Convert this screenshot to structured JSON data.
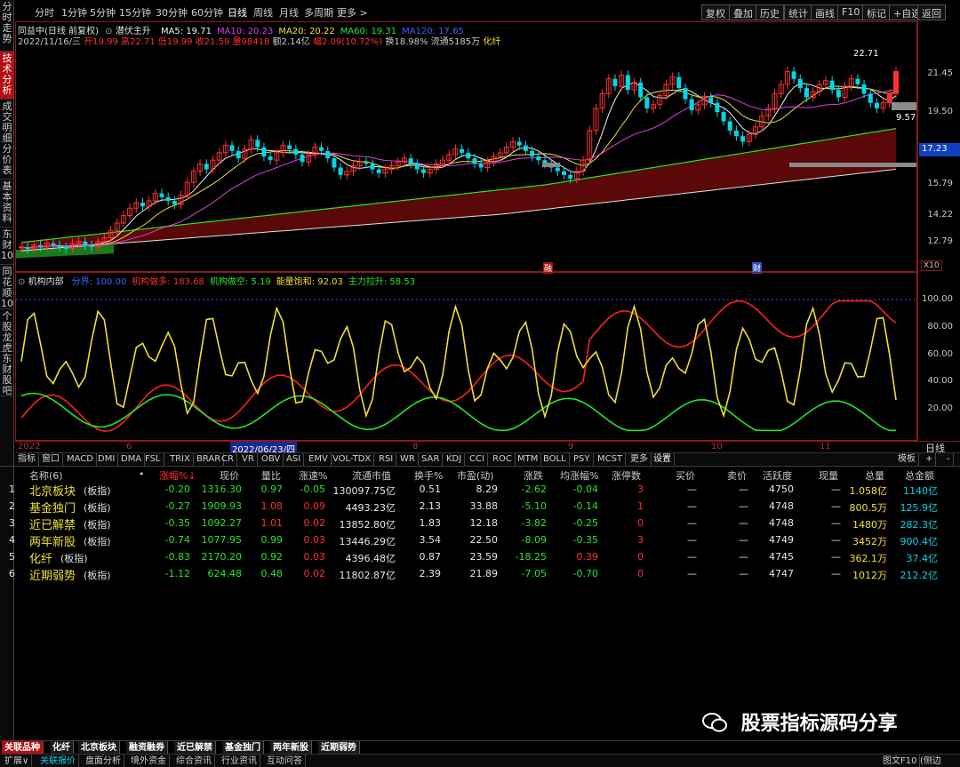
{
  "left_nav": [
    "分时走势",
    "技术分析",
    "成交明细",
    "分价表",
    "基本资料",
    "东财10",
    "同花顺10",
    "个股龙虎",
    "东财股吧"
  ],
  "toolbar": {
    "periods": [
      "分时",
      "1分钟",
      "5分钟",
      "15分钟",
      "30分钟",
      "60分钟",
      "日线",
      "周线",
      "月线",
      "多周期",
      "更多 >"
    ],
    "selected": "日线",
    "right_buttons": [
      "复权",
      "叠加",
      "历史",
      "统计",
      "画线",
      "F10",
      "标记",
      "+自选",
      "返回"
    ]
  },
  "main_chart": {
    "title": "同益中(日线 前复权)",
    "indicator": "潜伏主升",
    "ma": [
      {
        "label": "MA5: 19.71",
        "color": "#f0f0f0"
      },
      {
        "label": "MA10: 20.23",
        "color": "#e040e0"
      },
      {
        "label": "MA20: 20.22",
        "color": "#f0e030"
      },
      {
        "label": "MA60: 19.31",
        "color": "#27e627"
      },
      {
        "label": "MA120: 17.65",
        "color": "#4060ff"
      }
    ],
    "info": {
      "date": "2022/11/16/三",
      "open": "开19.99",
      "high": "高22.71",
      "low": "低19.99",
      "close": "收21.59",
      "vol": "量98418",
      "amount": "额2.14亿",
      "change": "幅2.09(10.72%)",
      "turnover": "换18.98%",
      "float": "流通5185万",
      "sector": "化纤"
    },
    "high_label": "22.71",
    "low_label": "9.57",
    "price_tag": "17.23",
    "markers": [
      "融",
      "财"
    ],
    "y_labels": [
      "21.45",
      "19.50",
      "17.23",
      "15.79",
      "14.22",
      "12.79"
    ],
    "x10": "X10"
  },
  "sub_chart": {
    "title": "机构内部",
    "legend": [
      {
        "label": "分界: 100.00",
        "color": "#4060ff"
      },
      {
        "label": "机构做多: 183.68",
        "color": "#ff3030"
      },
      {
        "label": "机构做空: 5.19",
        "color": "#27e627"
      },
      {
        "label": "能量饱和: 92.03",
        "color": "#f0e030"
      },
      {
        "label": "主力拉升: 58.53",
        "color": "#27e627"
      }
    ],
    "y_labels": [
      "100.00",
      "80.00",
      "60.00",
      "40.00",
      "20.00"
    ]
  },
  "date_axis": {
    "labels": [
      "2022",
      "6",
      "2022/06/23/四",
      "8",
      "9",
      "10",
      "11"
    ],
    "right": "日线"
  },
  "indicator_tabs": [
    "指标",
    "窗口",
    "MACD",
    "DMI",
    "DMA",
    "FSL",
    "TRIX",
    "BRAR",
    "CR",
    "VR",
    "OBV",
    "ASI",
    "EMV",
    "VOL-TDX",
    "RSI",
    "WR",
    "SAR",
    "KDJ",
    "CCI",
    "ROC",
    "MTM",
    "BOLL",
    "PSY",
    "MCST",
    "更多",
    "设置"
  ],
  "indicator_right": [
    "模板",
    "+",
    "-"
  ],
  "table": {
    "headers": [
      "名称(6)",
      "•",
      "涨幅%↓",
      "现价",
      "量比",
      "涨速%",
      "流通市值",
      "换手%",
      "市盈(动)",
      "涨跌",
      "均涨幅%",
      "涨停数",
      "买价",
      "卖价",
      "活跃度",
      "现量",
      "总量",
      "总金额"
    ],
    "rows": [
      {
        "idx": "1",
        "name": "北京板块",
        "tag": "(板指)",
        "chg": "-0.20",
        "price": "1316.30",
        "vr": "0.97",
        "spd": "-0.05",
        "mcap": "130097.75亿",
        "turn": "0.51",
        "pe": "8.29",
        "diff": "-2.62",
        "avg": "-0.04",
        "limit": "3",
        "bid": "—",
        "ask": "—",
        "act": "4750",
        "cur": "—",
        "vol": "1.058亿",
        "amt": "1140亿"
      },
      {
        "idx": "2",
        "name": "基金独门",
        "tag": "(板指)",
        "chg": "-0.27",
        "price": "1909.93",
        "vr": "1.08",
        "spd": "0.09",
        "mcap": "4493.23亿",
        "turn": "2.13",
        "pe": "33.88",
        "diff": "-5.10",
        "avg": "-0.14",
        "limit": "1",
        "bid": "—",
        "ask": "—",
        "act": "4748",
        "cur": "—",
        "vol": "800.5万",
        "amt": "125.9亿"
      },
      {
        "idx": "3",
        "name": "近已解禁",
        "tag": "(板指)",
        "chg": "-0.35",
        "price": "1092.27",
        "vr": "1.01",
        "spd": "0.02",
        "mcap": "13852.80亿",
        "turn": "1.83",
        "pe": "12.18",
        "diff": "-3.82",
        "avg": "-0.25",
        "limit": "0",
        "bid": "—",
        "ask": "—",
        "act": "4748",
        "cur": "—",
        "vol": "1480万",
        "amt": "282.3亿"
      },
      {
        "idx": "4",
        "name": "两年新股",
        "tag": "(板指)",
        "chg": "-0.74",
        "price": "1077.95",
        "vr": "0.99",
        "spd": "0.03",
        "mcap": "13446.29亿",
        "turn": "3.54",
        "pe": "22.50",
        "diff": "-8.09",
        "avg": "-0.35",
        "limit": "3",
        "bid": "—",
        "ask": "—",
        "act": "4749",
        "cur": "—",
        "vol": "3452万",
        "amt": "900.4亿"
      },
      {
        "idx": "5",
        "name": "化纤",
        "tag": "(板指)",
        "chg": "-0.83",
        "price": "2170.20",
        "vr": "0.92",
        "spd": "0.03",
        "mcap": "4396.48亿",
        "turn": "0.87",
        "pe": "23.59",
        "diff": "-18.25",
        "avg": "0.39",
        "limit": "0",
        "bid": "—",
        "ask": "—",
        "act": "4745",
        "cur": "—",
        "vol": "362.1万",
        "amt": "37.4亿"
      },
      {
        "idx": "6",
        "name": "近期弱势",
        "tag": "(板指)",
        "chg": "-1.12",
        "price": "624.48",
        "vr": "0.48",
        "spd": "0.02",
        "mcap": "11802.87亿",
        "turn": "2.39",
        "pe": "21.89",
        "diff": "-7.05",
        "avg": "-0.70",
        "limit": "0",
        "bid": "—",
        "ask": "—",
        "act": "4747",
        "cur": "—",
        "vol": "1012万",
        "amt": "212.2亿"
      }
    ]
  },
  "watermark": "股票指标源码分享",
  "block_tabs": [
    "关联品种",
    "化纤",
    "北京板块",
    "融资融券",
    "近已解禁",
    "基金独门",
    "两年新股",
    "近期弱势"
  ],
  "status_bar": {
    "left": [
      "扩展∨",
      "关联报价",
      "盘面分析",
      "境外资金",
      "综合资讯",
      "行业资讯",
      "互动问答"
    ],
    "right": [
      "图文F10",
      "(侧边栏»)"
    ]
  }
}
